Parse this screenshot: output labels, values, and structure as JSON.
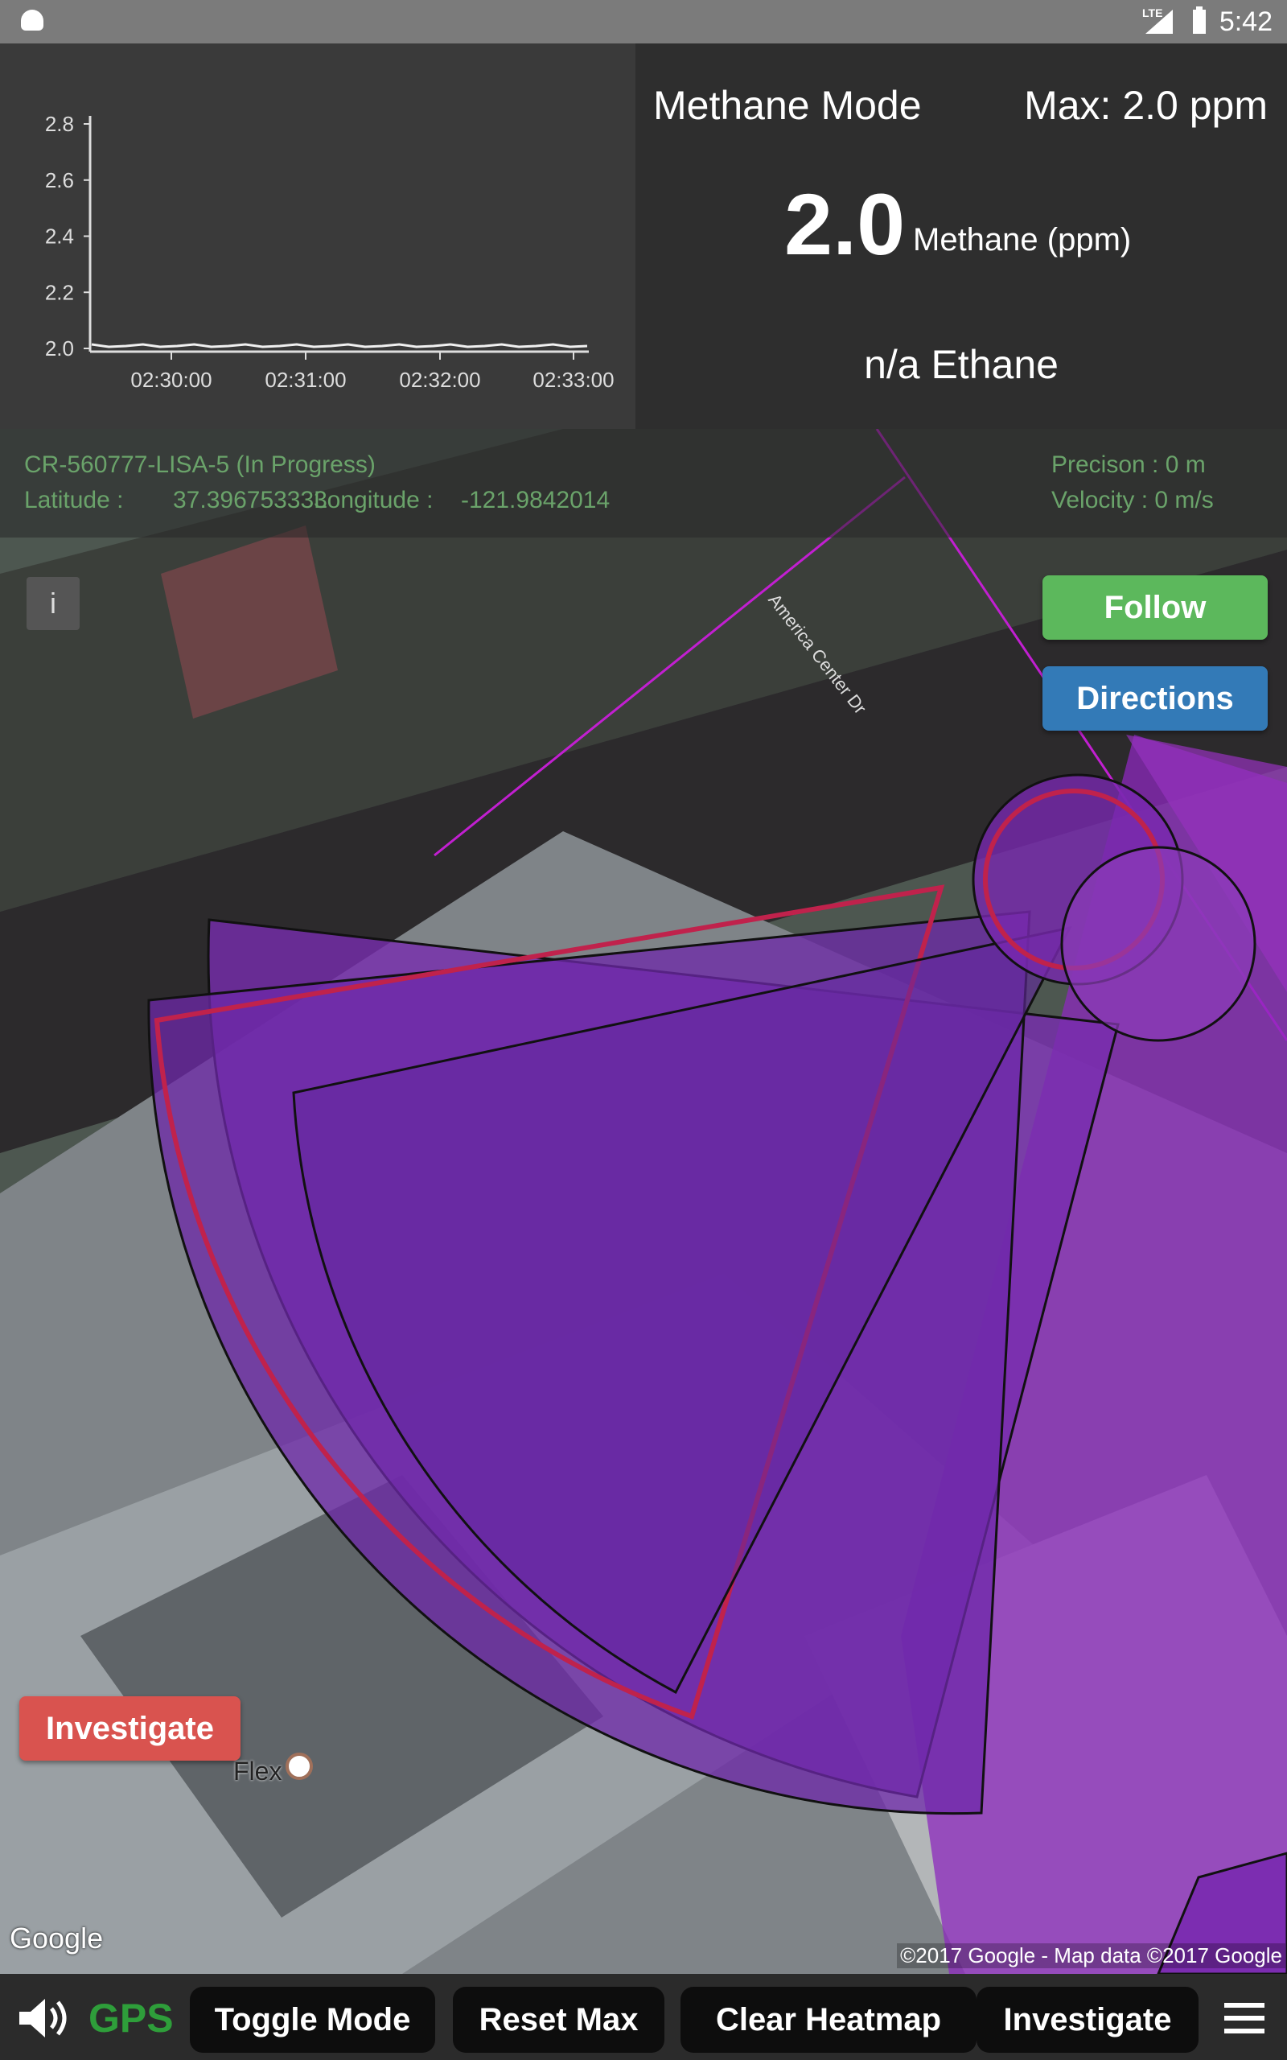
{
  "status_bar": {
    "time": "5:42",
    "network": "LTE"
  },
  "chart_data": {
    "type": "line",
    "x_ticks": [
      "02:30:00",
      "02:31:00",
      "02:32:00",
      "02:33:00"
    ],
    "y_ticks": [
      "2.0",
      "2.2",
      "2.4",
      "2.6",
      "2.8"
    ],
    "ylim": [
      2.0,
      2.8
    ],
    "series": [
      {
        "values": [
          2.0,
          2.0,
          2.0,
          2.0,
          2.0,
          2.0,
          2.0,
          2.0,
          2.0,
          2.0,
          2.0,
          2.0,
          2.0,
          2.0,
          2.0,
          2.0,
          2.0,
          2.0,
          2.0,
          2.0,
          2.0,
          2.0,
          2.0,
          2.0,
          2.0,
          2.0,
          2.0,
          2.0,
          2.0,
          2.0
        ]
      }
    ]
  },
  "reading": {
    "mode": "Methane Mode",
    "max": "Max: 2.0 ppm",
    "value": "2.0",
    "unit": "Methane (ppm)",
    "ethane": "n/a Ethane"
  },
  "map_info": {
    "job": "CR-560777-LISA-5  (In Progress)",
    "latitude_label": "Latitude :",
    "latitude": "37.396753333",
    "longitude_label": "Longitude  :",
    "longitude": "-121.9842014",
    "precision": "Precison : 0  m",
    "velocity": "Velocity : 0  m/s"
  },
  "map": {
    "street": "America Center Dr",
    "poi": "Flex",
    "logo": "Google",
    "copyright": "©2017 Google - Map data ©2017 Google"
  },
  "buttons": {
    "follow": "Follow",
    "directions": "Directions",
    "investigate": "Investigate"
  },
  "bottom_bar": {
    "gps": "GPS",
    "toggle_mode": "Toggle Mode",
    "reset_max": "Reset Max",
    "clear_heatmap": "Clear Heatmap",
    "investigate": "Investigate"
  },
  "colors": {
    "follow": "#5cb85c",
    "directions": "#337ab7",
    "investigate": "#d9534f",
    "gps": "#2e9e3a",
    "plume": "#7b2fb0"
  }
}
